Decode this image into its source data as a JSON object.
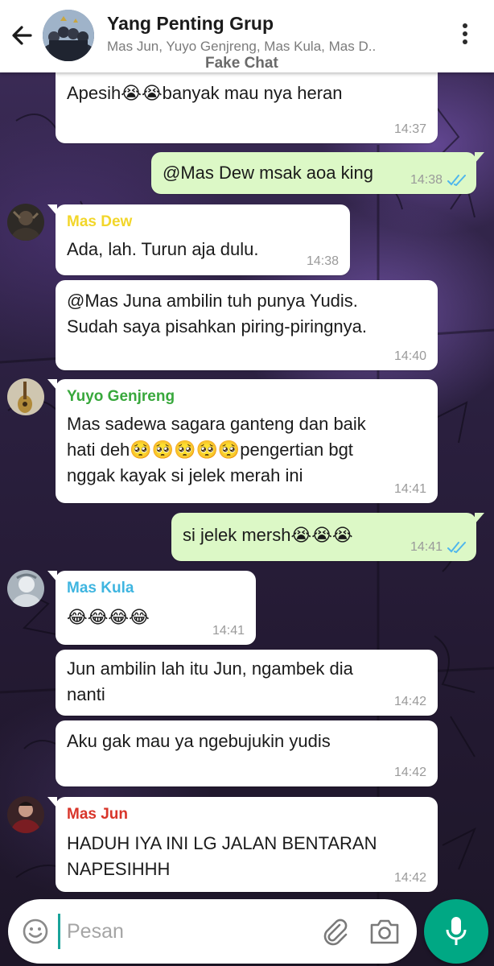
{
  "header": {
    "title": "Yang Penting Grup",
    "members": "Mas Jun, Yuyo Genjreng, Mas Kula, Mas D..",
    "watermark": "Fake Chat"
  },
  "messages": [
    {
      "text": "Apesih😭😭banyak mau nya heran",
      "time": "14:37"
    },
    {
      "text": "@Mas Dew msak aoa king",
      "time": "14:38",
      "outgoing": true
    },
    {
      "sender": "Mas Dew",
      "sender_color": "#f2d62a",
      "text": "Ada, lah. Turun aja dulu.",
      "time": "14:38"
    },
    {
      "text_lines": [
        "@Mas Juna ambilin tuh punya Yudis.",
        "Sudah saya pisahkan piring-piringnya."
      ],
      "time": "14:40"
    },
    {
      "sender": "Yuyo Genjreng",
      "sender_color": "#38a83c",
      "text_lines": [
        "Mas sadewa sagara ganteng dan baik",
        "hati deh🥺🥺🥺🥺🥺pengertian bgt",
        "nggak kayak si jelek merah ini"
      ],
      "time": "14:41"
    },
    {
      "text": "si jelek mersh😭😭😭",
      "time": "14:41",
      "outgoing": true
    },
    {
      "sender": "Mas Kula",
      "sender_color": "#3fb5e0",
      "text": "😂😂😂😂",
      "time": "14:41"
    },
    {
      "text_lines": [
        "Jun ambilin lah itu Jun, ngambek dia",
        "nanti"
      ],
      "time": "14:42"
    },
    {
      "text": "Aku gak mau ya ngebujukin yudis",
      "time": "14:42"
    },
    {
      "sender": "Mas Jun",
      "sender_color": "#d8352a",
      "text_lines": [
        "HADUH IYA INI LG JALAN BENTARAN",
        "NAPESIHHH"
      ],
      "time": "14:42"
    }
  ],
  "composer": {
    "placeholder": "Pesan"
  },
  "icons": {
    "back": "arrow-left-icon",
    "menu": "kebab-menu-icon",
    "emoji": "smiley-icon",
    "attach": "paperclip-icon",
    "camera": "camera-icon",
    "mic": "microphone-icon",
    "read_receipt": "double-check-icon"
  },
  "colors": {
    "outgoing_bubble": "#dcf8c6",
    "incoming_bubble": "#ffffff",
    "read_ticks": "#4fb6ec",
    "mic_button": "#00a884"
  }
}
